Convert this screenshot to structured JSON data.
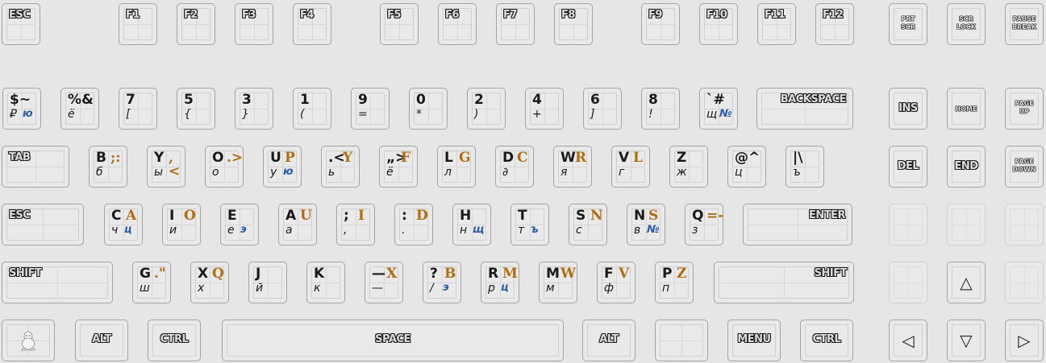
{
  "keyboard": {
    "function_row": {
      "esc": "ESC",
      "f1": "F1",
      "f2": "F2",
      "f3": "F3",
      "f4": "F4",
      "f5": "F5",
      "f6": "F6",
      "f7": "F7",
      "f8": "F8",
      "f9": "F9",
      "f10": "F10",
      "f11": "F11",
      "f12": "F12"
    },
    "system_keys": {
      "prt_scr_top": "PRT",
      "prt_scr_bottom": "SCR",
      "scr_lock_top": "SCR",
      "scr_lock_bottom": "LOCK",
      "pause_top": "PAUSE",
      "pause_bottom": "BREAK"
    },
    "number_row": [
      {
        "tl": "$~",
        "tr": "",
        "bl": "₽",
        "br": "ю"
      },
      {
        "tl": "%&",
        "tr": "",
        "bl": "ё",
        "br": ""
      },
      {
        "tl": "7",
        "tr": "",
        "bl": "[",
        "br": ""
      },
      {
        "tl": "5",
        "tr": "",
        "bl": "{",
        "br": ""
      },
      {
        "tl": "3",
        "tr": "",
        "bl": "}",
        "br": ""
      },
      {
        "tl": "1",
        "tr": "",
        "bl": "(",
        "br": ""
      },
      {
        "tl": "9",
        "tr": "",
        "bl": "=",
        "br": ""
      },
      {
        "tl": "0",
        "tr": "",
        "bl": "*",
        "br": ""
      },
      {
        "tl": "2",
        "tr": "",
        "bl": ")",
        "br": ""
      },
      {
        "tl": "4",
        "tr": "",
        "bl": "+",
        "br": ""
      },
      {
        "tl": "6",
        "tr": "",
        "bl": "]",
        "br": ""
      },
      {
        "tl": "8",
        "tr": "",
        "bl": "!",
        "br": ""
      },
      {
        "tl": "`#",
        "tr": "",
        "bl": "щ",
        "br": "№"
      }
    ],
    "backspace": "BACKSPACE",
    "tab": "TAB",
    "top_row": [
      {
        "tl": "B",
        "tr": ";:",
        "bl": "б",
        "br": ""
      },
      {
        "tl": "Y",
        "tr": ",<",
        "bl": "ы",
        "br": ""
      },
      {
        "tl": "O",
        "tr": ".>",
        "bl": "о",
        "br": ""
      },
      {
        "tl": "U",
        "tr": "P",
        "bl": "у",
        "br": "ю"
      },
      {
        "tl": ".<",
        "tr": "Y",
        "bl": "ь",
        "br": ""
      },
      {
        "tl": "„>",
        "tr": "F",
        "bl": "ё",
        "br": ""
      },
      {
        "tl": "L",
        "tr": "G",
        "bl": "л",
        "br": ""
      },
      {
        "tl": "D",
        "tr": "C",
        "bl": "∂",
        "br": ""
      },
      {
        "tl": "W",
        "tr": "R",
        "bl": "я",
        "br": ""
      },
      {
        "tl": "V",
        "tr": "L",
        "bl": "г",
        "br": ""
      },
      {
        "tl": "Z",
        "tr": "",
        "bl": "ж",
        "br": ""
      },
      {
        "tl": "@^",
        "tr": "",
        "bl": "ц",
        "br": ""
      },
      {
        "tl": "|\\",
        "tr": "",
        "bl": "ъ",
        "br": ""
      }
    ],
    "caps": "ESC",
    "home_row": [
      {
        "tl": "C",
        "tr": "A",
        "bl": "ч",
        "br": "ц"
      },
      {
        "tl": "I",
        "tr": "O",
        "bl": "и",
        "br": ""
      },
      {
        "tl": "E",
        "tr": "",
        "bl": "е",
        "br": "э"
      },
      {
        "tl": "A",
        "tr": "U",
        "bl": "а",
        "br": ""
      },
      {
        "tl": ";",
        "tr": "I",
        "bl": ",",
        "br": ""
      },
      {
        "tl": ":",
        "tr": "D",
        "bl": ".",
        "br": ""
      },
      {
        "tl": "H",
        "tr": "",
        "bl": "н",
        "br": "щ"
      },
      {
        "tl": "T",
        "tr": "",
        "bl": "т",
        "br": "ъ"
      },
      {
        "tl": "S",
        "tr": "N",
        "bl": "с",
        "br": ""
      },
      {
        "tl": "N",
        "tr": "S",
        "bl": "в",
        "br": "№"
      },
      {
        "tl": "Q",
        "tr": "=-",
        "bl": "з",
        "br": ""
      }
    ],
    "enter": "ENTER",
    "shift_left": "SHIFT",
    "bottom_row": [
      {
        "tl": "G",
        "tr": ".\"",
        "bl": "ш",
        "br": ""
      },
      {
        "tl": "X",
        "tr": "Q",
        "bl": "х",
        "br": ""
      },
      {
        "tl": "J",
        "tr": "",
        "bl": "й",
        "br": ""
      },
      {
        "tl": "K",
        "tr": "",
        "bl": "к",
        "br": ""
      },
      {
        "tl": "—",
        "tr": "X",
        "bl": "—",
        "br": ""
      },
      {
        "tl": "?",
        "tr": "B",
        "bl": "/",
        "br": "э"
      },
      {
        "tl": "R",
        "tr": "M",
        "bl": "р",
        "br": "ц"
      },
      {
        "tl": "M",
        "tr": "W",
        "bl": "м",
        "br": ""
      },
      {
        "tl": "F",
        "tr": "V",
        "bl": "ф",
        "br": ""
      },
      {
        "tl": "P",
        "tr": "Z",
        "bl": "п",
        "br": ""
      }
    ],
    "shift_right": "SHIFT",
    "space_row": {
      "alt_left": "ALT",
      "ctrl_left": "CTRL",
      "space": "SPACE",
      "alt_right": "ALT",
      "menu": "MENU",
      "ctrl_right": "CTRL"
    },
    "nav_keys": {
      "ins": "INS",
      "home": "HOME",
      "page_up_top": "PAGE",
      "page_up_bottom": "UP",
      "del": "DEL",
      "end": "END",
      "page_down_top": "PAGE",
      "page_down_bottom": "DOWN"
    },
    "arrow_keys": {
      "up": "△",
      "left": "◁",
      "down": "▽",
      "right": "▷"
    },
    "colors": {
      "accent_orange": "#b06d10",
      "accent_blue": "#2a5ca8",
      "label_dark": "#1a1a1a"
    },
    "icons": {
      "super_key": "tux-penguin-icon"
    }
  }
}
